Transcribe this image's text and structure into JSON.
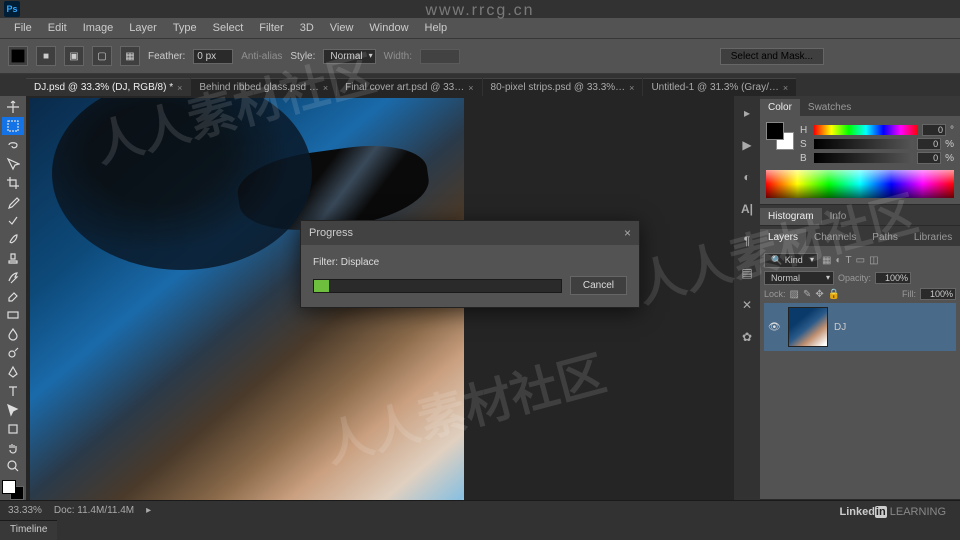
{
  "menu": {
    "items": [
      "File",
      "Edit",
      "Image",
      "Layer",
      "Type",
      "Select",
      "Filter",
      "3D",
      "View",
      "Window",
      "Help"
    ]
  },
  "options": {
    "feather_label": "Feather:",
    "feather_value": "0 px",
    "antialias": "Anti-alias",
    "style_label": "Style:",
    "style_value": "Normal",
    "width_label": "Width:",
    "mask_button": "Select and Mask..."
  },
  "tabs": [
    {
      "label": "DJ.psd @ 33.3% (DJ, RGB/8) *",
      "active": true
    },
    {
      "label": "Behind ribbed glass.psd …",
      "active": false
    },
    {
      "label": "Final cover art.psd @ 33…",
      "active": false
    },
    {
      "label": "80-pixel strips.psd @ 33.3%…",
      "active": false
    },
    {
      "label": "Untitled-1 @ 31.3% (Gray/…",
      "active": false
    }
  ],
  "progress": {
    "title": "Progress",
    "label": "Filter: Displace",
    "cancel": "Cancel"
  },
  "panels": {
    "color_tab": "Color",
    "swatches_tab": "Swatches",
    "h": "0",
    "s": "0",
    "b": "0",
    "hist_tab": "Histogram",
    "info_tab": "Info",
    "layers_tab": "Layers",
    "channels_tab": "Channels",
    "paths_tab": "Paths",
    "libraries_tab": "Libraries",
    "kind": "Kind",
    "blend": "Normal",
    "opacity_label": "Opacity:",
    "opacity": "100%",
    "lock_label": "Lock:",
    "fill_label": "Fill:",
    "fill": "100%",
    "layer_name": "DJ"
  },
  "status": {
    "zoom": "33.33%",
    "doc": "Doc: 11.4M/11.4M",
    "timeline": "Timeline"
  },
  "watermark": {
    "url": "www.rrcg.cn",
    "text": "人人素材社区"
  },
  "footer": {
    "brand1": "Linked",
    "brand2": "in",
    "brand3": " LEARNING"
  }
}
